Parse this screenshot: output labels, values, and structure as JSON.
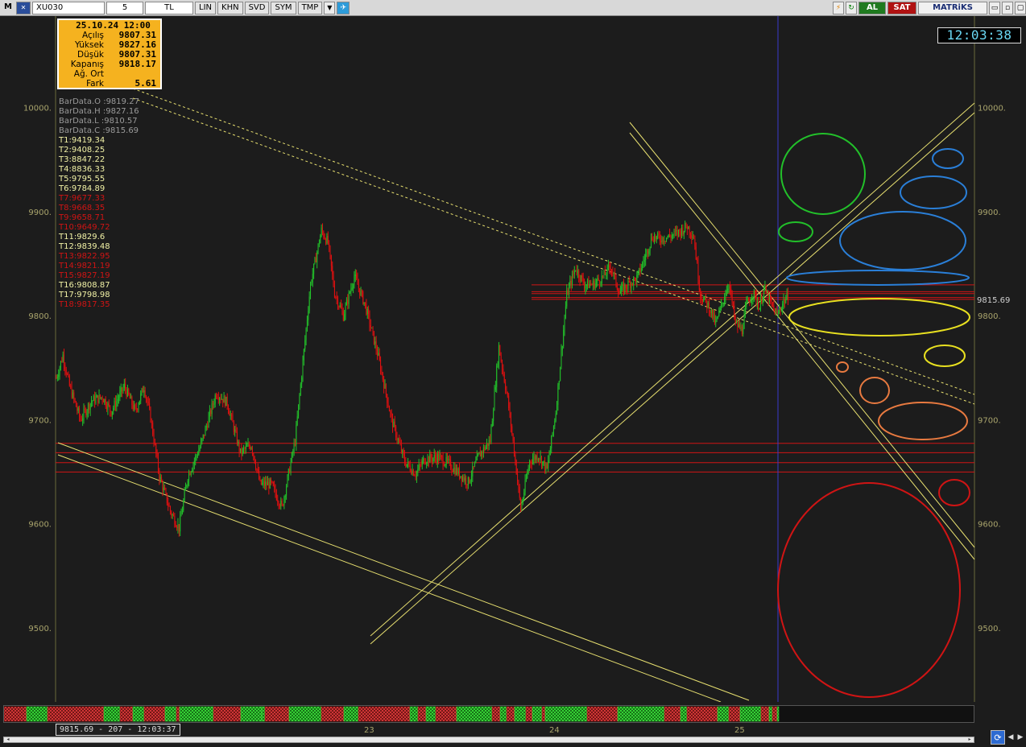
{
  "toolbar": {
    "m_label": "M",
    "symbol": "XU030",
    "period": "5",
    "currency": "TL",
    "buttons": [
      "LIN",
      "KHN",
      "SVD",
      "SYM",
      "TMP"
    ],
    "buy_label": "AL",
    "sell_label": "SAT",
    "logo": "MATRiKS",
    "win_min": "▭",
    "win_restore": "▫",
    "win_close": "▢"
  },
  "infobox": {
    "date": "25.10.24 12:00",
    "rows": [
      {
        "label": "Açılış",
        "value": "9807.31"
      },
      {
        "label": "Yüksek",
        "value": "9827.16"
      },
      {
        "label": "Düşük",
        "value": "9807.31"
      },
      {
        "label": "Kapanış",
        "value": "9818.17"
      },
      {
        "label": "Ağ. Ort",
        "value": ""
      },
      {
        "label": "Fark",
        "value": "5.61"
      }
    ]
  },
  "bardata": [
    {
      "text": "BarData.O :9819.27",
      "color": "#9a9a9a"
    },
    {
      "text": "BarData.H :9827.16",
      "color": "#9a9a9a"
    },
    {
      "text": "BarData.L :9810.57",
      "color": "#9a9a9a"
    },
    {
      "text": "BarData.C :9815.69",
      "color": "#9a9a9a"
    },
    {
      "text": "T1:9419.34",
      "color": "#f2f2a6"
    },
    {
      "text": "T2:9408.25",
      "color": "#f2f2a6"
    },
    {
      "text": "T3:8847.22",
      "color": "#f2f2a6"
    },
    {
      "text": "T4:8836.33",
      "color": "#f2f2a6"
    },
    {
      "text": "T5:9795.55",
      "color": "#f2f2a6"
    },
    {
      "text": "T6:9784.89",
      "color": "#f2f2a6"
    },
    {
      "text": "T7:9677.33",
      "color": "#d01414"
    },
    {
      "text": "T8:9668.35",
      "color": "#d01414"
    },
    {
      "text": "T9:9658.71",
      "color": "#d01414"
    },
    {
      "text": "T10:9649.72",
      "color": "#d01414"
    },
    {
      "text": "T11:9829.6",
      "color": "#f2f2a6"
    },
    {
      "text": "T12:9839.48",
      "color": "#f2f2a6"
    },
    {
      "text": "T13:9822.95",
      "color": "#d01414"
    },
    {
      "text": "T14:9821.19",
      "color": "#d01414"
    },
    {
      "text": "T15:9827.19",
      "color": "#d01414"
    },
    {
      "text": "T16:9808.87",
      "color": "#f2f2a6"
    },
    {
      "text": "T17:9798.98",
      "color": "#f2f2a6"
    },
    {
      "text": "T18:9817.35",
      "color": "#d01414"
    }
  ],
  "clock": "12:03:38",
  "last_price_label": "9815.69",
  "readout": "9815.69 - 207 - 12:03:37",
  "date_ticks": [
    "23",
    "24",
    "25"
  ],
  "colors": {
    "up": "#22c02a",
    "down": "#e01010",
    "trendline": "#e8e070",
    "hline": "#d01414",
    "axis_text": "#a9a46c",
    "current_line": "#3a3acc"
  },
  "chart_data": {
    "type": "candlestick",
    "ylim": [
      9440,
      10040
    ],
    "yticks": [
      9500,
      9600,
      9700,
      9800,
      9900,
      10000
    ],
    "ytick_labels": [
      "9500.",
      "9600.",
      "9700.",
      "9800.",
      "9900.",
      "10000."
    ],
    "anchors": [
      [
        0,
        9740
      ],
      [
        6,
        9762
      ],
      [
        12,
        9732
      ],
      [
        22,
        9700
      ],
      [
        32,
        9718
      ],
      [
        42,
        9722
      ],
      [
        50,
        9708
      ],
      [
        62,
        9732
      ],
      [
        72,
        9708
      ],
      [
        80,
        9732
      ],
      [
        86,
        9702
      ],
      [
        94,
        9646
      ],
      [
        104,
        9612
      ],
      [
        112,
        9596
      ],
      [
        120,
        9646
      ],
      [
        132,
        9676
      ],
      [
        146,
        9726
      ],
      [
        156,
        9716
      ],
      [
        168,
        9668
      ],
      [
        178,
        9676
      ],
      [
        186,
        9638
      ],
      [
        196,
        9638
      ],
      [
        206,
        9616
      ],
      [
        218,
        9680
      ],
      [
        232,
        9830
      ],
      [
        242,
        9882
      ],
      [
        248,
        9870
      ],
      [
        254,
        9822
      ],
      [
        262,
        9800
      ],
      [
        272,
        9838
      ],
      [
        282,
        9810
      ],
      [
        294,
        9760
      ],
      [
        306,
        9700
      ],
      [
        318,
        9660
      ],
      [
        328,
        9648
      ],
      [
        336,
        9662
      ],
      [
        348,
        9664
      ],
      [
        358,
        9658
      ],
      [
        366,
        9650
      ],
      [
        376,
        9640
      ],
      [
        386,
        9666
      ],
      [
        396,
        9680
      ],
      [
        404,
        9770
      ],
      [
        412,
        9720
      ],
      [
        418,
        9670
      ],
      [
        424,
        9614
      ],
      [
        432,
        9660
      ],
      [
        440,
        9666
      ],
      [
        448,
        9652
      ],
      [
        456,
        9708
      ],
      [
        466,
        9820
      ],
      [
        474,
        9846
      ],
      [
        482,
        9830
      ],
      [
        490,
        9830
      ],
      [
        500,
        9838
      ],
      [
        506,
        9848
      ],
      [
        514,
        9822
      ],
      [
        522,
        9830
      ],
      [
        530,
        9836
      ],
      [
        536,
        9852
      ],
      [
        544,
        9876
      ],
      [
        550,
        9874
      ],
      [
        560,
        9876
      ],
      [
        568,
        9880
      ],
      [
        576,
        9886
      ],
      [
        582,
        9876
      ],
      [
        588,
        9820
      ],
      [
        596,
        9808
      ],
      [
        602,
        9792
      ],
      [
        608,
        9812
      ],
      [
        614,
        9832
      ],
      [
        620,
        9792
      ],
      [
        626,
        9786
      ],
      [
        630,
        9810
      ],
      [
        636,
        9822
      ],
      [
        642,
        9808
      ],
      [
        646,
        9826
      ],
      [
        652,
        9812
      ],
      [
        658,
        9800
      ],
      [
        664,
        9814
      ],
      [
        668,
        9818
      ]
    ],
    "horizontal_lines": [
      9677.33,
      9668.35,
      9658.71,
      9649.72,
      9829.6,
      9822.95,
      9821.19,
      9817.35,
      9815.69
    ],
    "last_price": 9815.69,
    "date_separators": [
      "23",
      "24",
      "25"
    ]
  }
}
